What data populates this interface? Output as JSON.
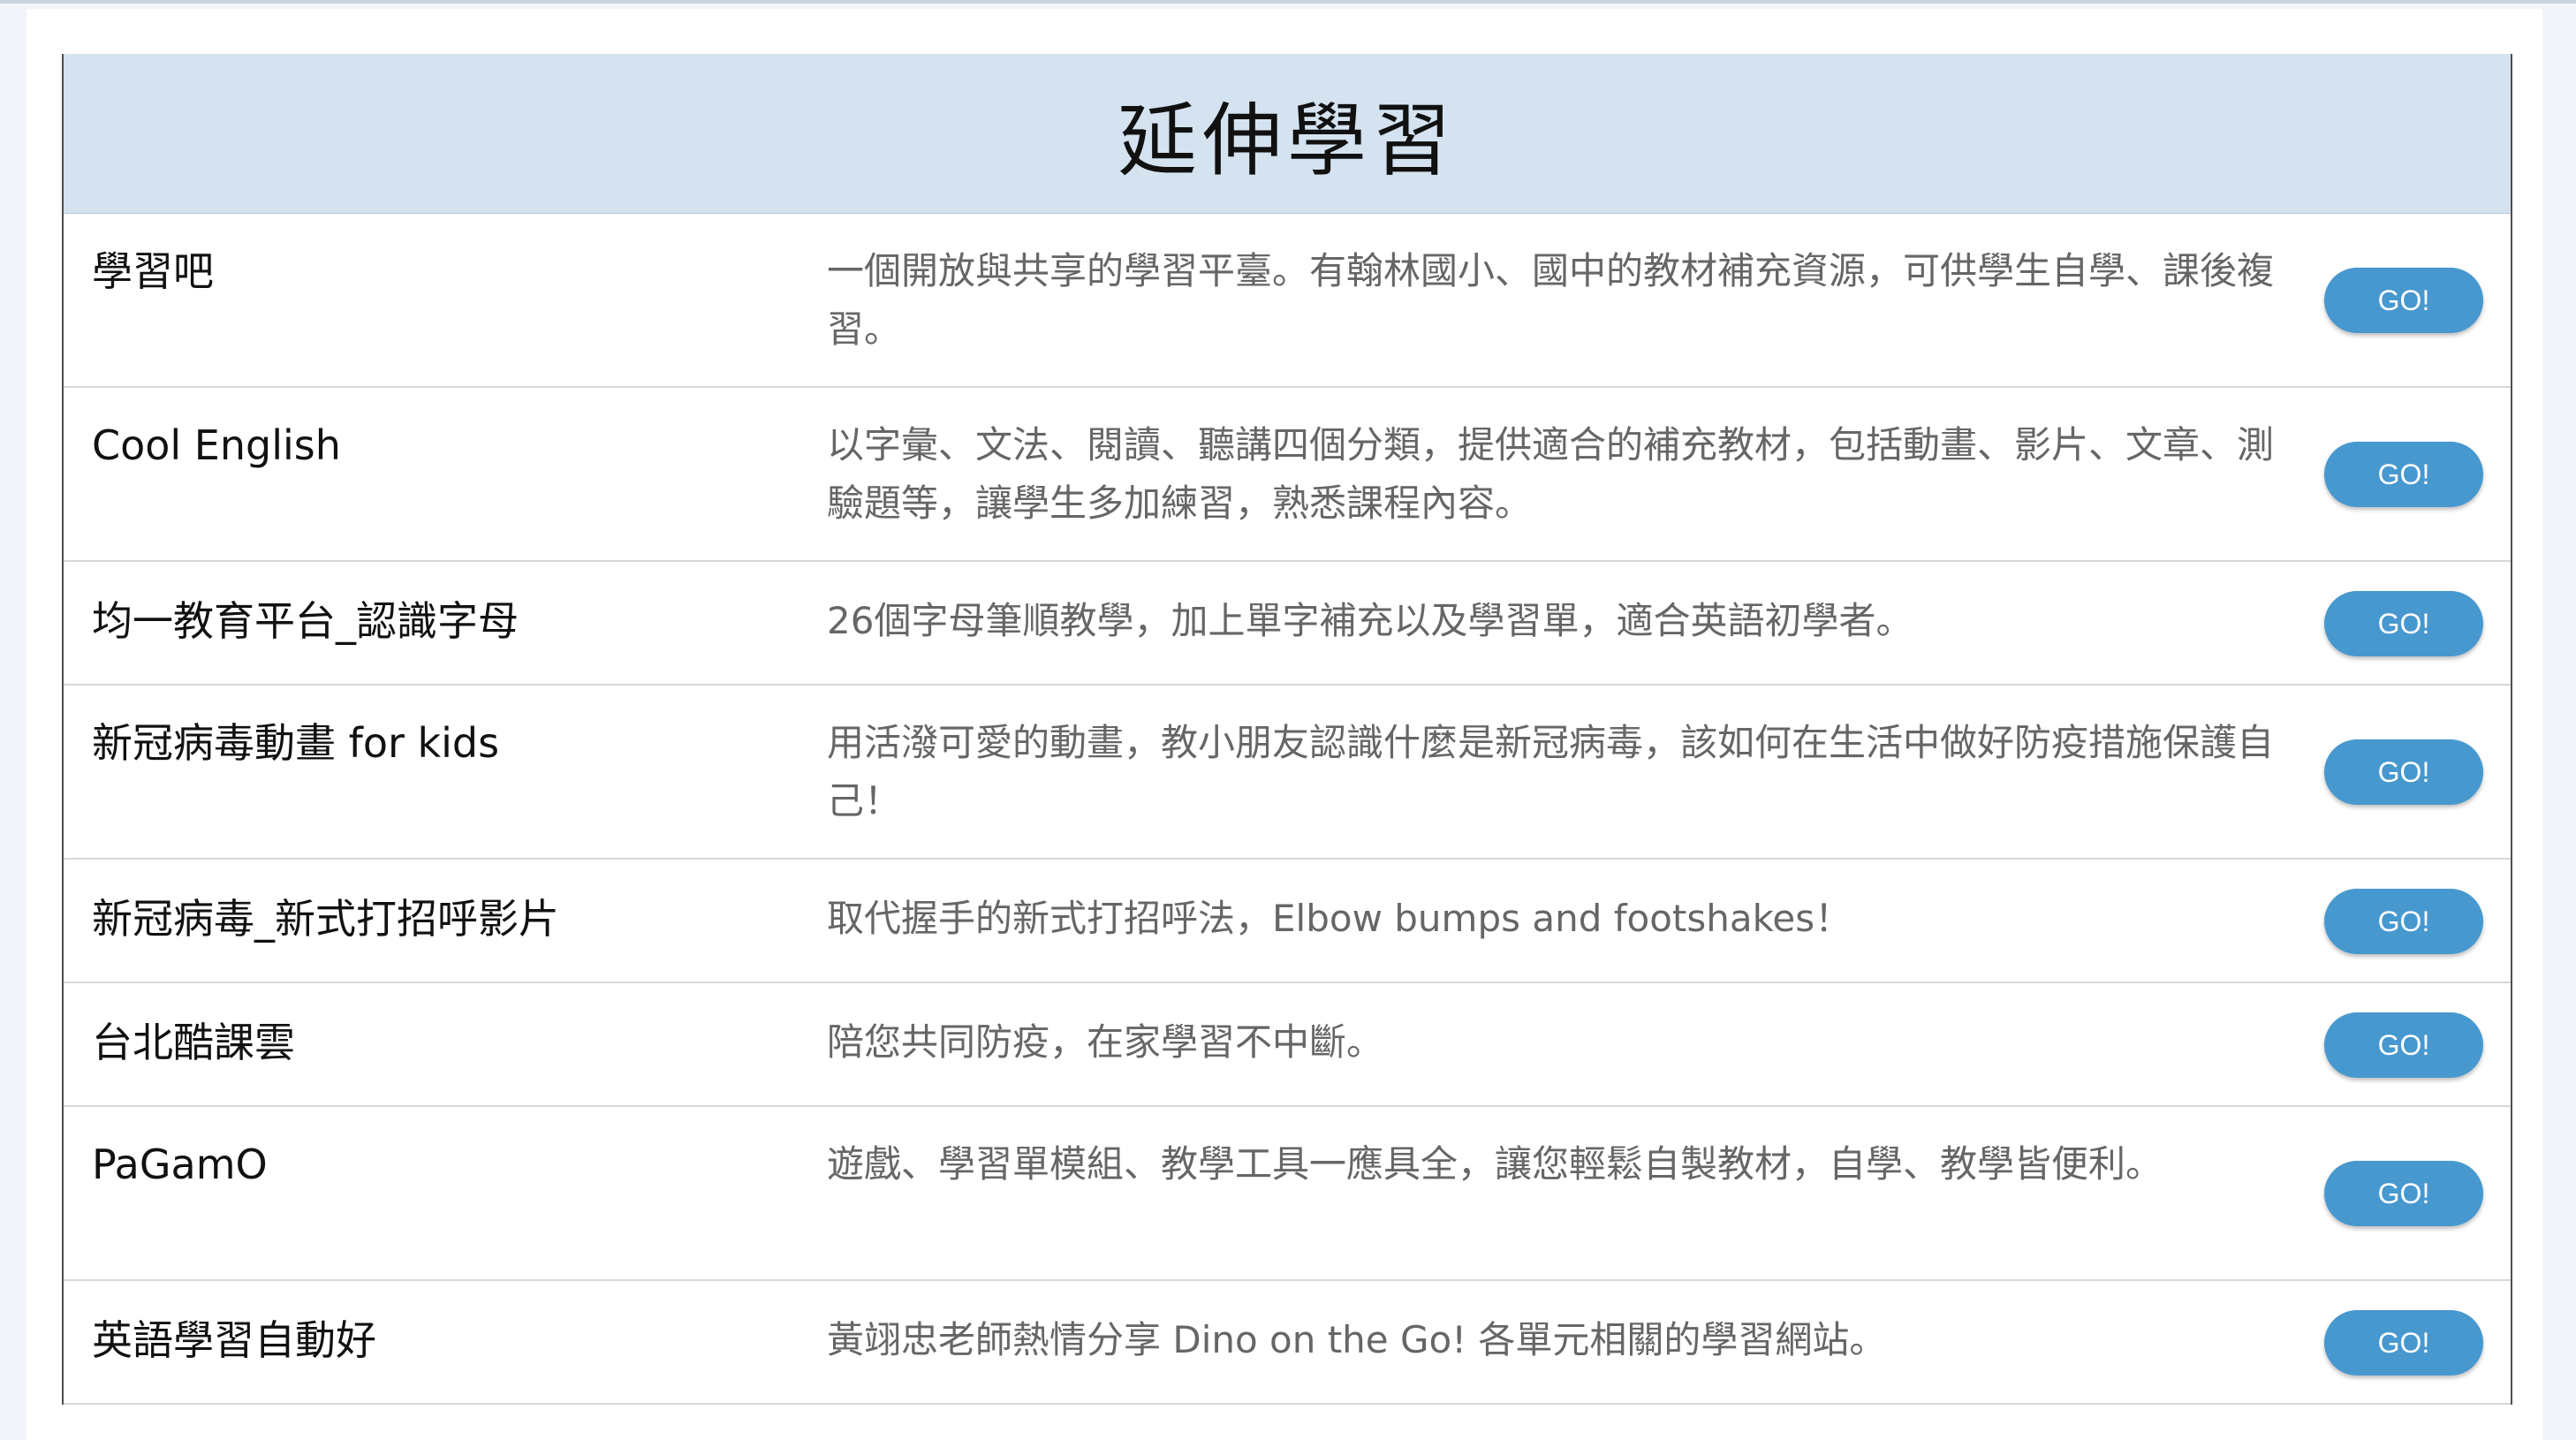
{
  "header": {
    "title": "延伸學習"
  },
  "rows": [
    {
      "name": "學習吧",
      "desc": "一個開放與共享的學習平臺。有翰林國小、國中的教材補充資源，可供學生自學、課後複習。",
      "button": "GO!"
    },
    {
      "name": "Cool English",
      "desc": "以字彙、文法、閱讀、聽講四個分類，提供適合的補充教材，包括動畫、影片、文章、測驗題等，讓學生多加練習，熟悉課程內容。",
      "button": "GO!"
    },
    {
      "name": "均一教育平台_認識字母",
      "desc": "26個字母筆順教學，加上單字補充以及學習單，適合英語初學者。",
      "button": "GO!"
    },
    {
      "name": "新冠病毒動畫 for kids",
      "desc": "用活潑可愛的動畫，教小朋友認識什麼是新冠病毒，該如何在生活中做好防疫措施保護自己！",
      "button": "GO!"
    },
    {
      "name": "新冠病毒_新式打招呼影片",
      "desc": "取代握手的新式打招呼法，Elbow bumps and footshakes！",
      "button": "GO!"
    },
    {
      "name": "台北酷課雲",
      "desc": "陪您共同防疫，在家學習不中斷。",
      "button": "GO!"
    },
    {
      "name": "PaGamO",
      "desc": "遊戲、學習單模組、教學工具一應具全，讓您輕鬆自製教材，自學、教學皆便利。",
      "button": "GO!"
    },
    {
      "name": "英語學習自動好",
      "desc": "黃翊忠老師熱情分享 Dino on the Go! 各單元相關的學習網站。",
      "button": "GO!"
    }
  ]
}
